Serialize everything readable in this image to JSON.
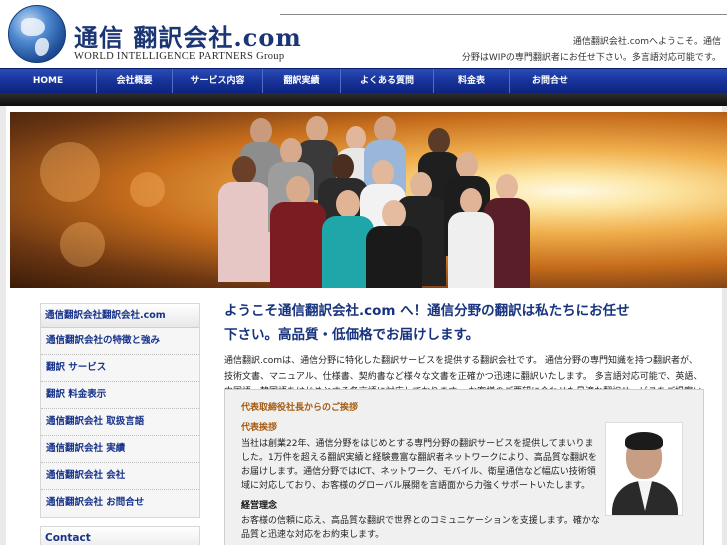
{
  "header": {
    "logo_main": "通信 翻訳会社.com",
    "logo_sub": "WORLD INTELLIGENCE PARTNERS Group",
    "tagline1": "通信翻訳会社.comへようこそ。通信",
    "tagline2": "分野はWIPの専門翻訳者にお任せ下さい。多言語対応可能です。"
  },
  "nav": {
    "items": [
      "HOME",
      "会社概要",
      "サービス内容",
      "翻訳実績",
      "よくある質問",
      "料金表",
      "お問合せ"
    ]
  },
  "sidebar": {
    "title": "通信翻訳会社翻訳会社.com",
    "items": [
      "通信翻訳会社の特徴と強み",
      "翻訳 サービス",
      "翻訳 料金表示",
      "通信翻訳会社 取扱言語",
      "通信翻訳会社 実績",
      "通信翻訳会社 会社",
      "通信翻訳会社 お問合せ"
    ],
    "contact": "Contact"
  },
  "main": {
    "title1": "ようこそ通信翻訳会社.com へ！通信分野の翻訳は私たちにお任せ",
    "title2": "下さい。高品質・低価格でお届けします。",
    "intro": "通信翻訳.comは、通信分野に特化した翻訳サービスを提供する翻訳会社です。 通信分野の専門知識を持つ翻訳者が、技術文書、マニュアル、仕様書、契約書など様々な文書を正確かつ迅速に翻訳いたします。 多言語対応可能で、英語、中国語、韓国語をはじめとする各言語に対応しております。 お客様のご要望に合わせた最適な翻訳サービスをご提案いたします。"
  },
  "profile": {
    "heading": "代表取締役社長からのご挨拶",
    "name": "代表挨拶",
    "text": "当社は創業22年、通信分野をはじめとする専門分野の翻訳サービスを提供してまいりました。1万件を超える翻訳実績と経験豊富な翻訳者ネットワークにより、高品質な翻訳をお届けします。通信分野ではICT、ネットワーク、モバイル、衛星通信など幅広い技術領域に対応しており、お客様のグローバル展開を言語面から力強くサポートいたします。",
    "sub": "経営理念",
    "text2": "お客様の信頼に応え、高品質な翻訳で世界とのコミュニケーションを支援します。確かな品質と迅速な対応をお約束します。"
  },
  "colors": {
    "nav_blue": "#17339a",
    "link_blue": "#17338a",
    "accent_orange": "#a45a0c"
  }
}
